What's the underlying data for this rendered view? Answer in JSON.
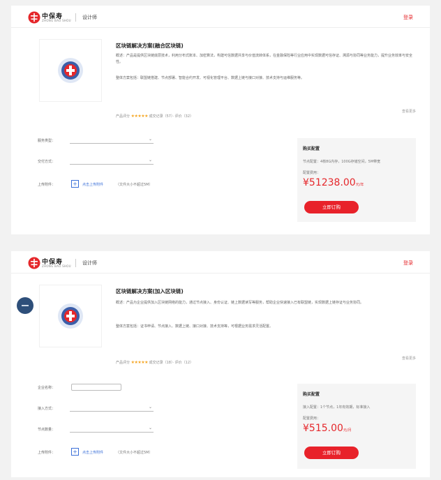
{
  "screens": [
    {
      "header": {
        "brand_cn": "中保寿",
        "brand_en": "ZHONG BAO SHOU",
        "nav": "设计师",
        "login": "登录"
      },
      "product": {
        "title": "区块链解决方案(融合区块链)",
        "desc1": "概述：产品是提供区块链底层技术，利用分布式账本、加密算法，构建可信数据共享与价值流转体系，在金融保险等行业应用中实现数据可信存证、溯源与协同等业务能力，提升业务效率与安全性。",
        "desc2": "整体方案包括：联盟链搭建、节点部署、智能合约开发、可视化管理平台、数据上链与接口对接、技术支持与运维服务等。",
        "rating_label": "产品评分",
        "stars": "★★★★★",
        "rating_meta": "成交记录（57）· 评价（32）",
        "more": "查看更多"
      },
      "form": {
        "field1_label": "服务类型：",
        "field2_label": "交付方式：",
        "upload_label": "上传附件：",
        "upload_link": "点击上传附件",
        "upload_tip": "（文件大小不超过5M）"
      },
      "pricebox": {
        "title": "购买配置",
        "spec": "节点配置：4核8G内存，100G存储空间，5M带宽",
        "price_label": "配置费用：",
        "price": "¥51238.00",
        "unit": "元/年",
        "buy": "立即订购"
      }
    },
    {
      "header": {
        "brand_cn": "中保寿",
        "brand_en": "ZHONG BAO SHOU",
        "nav": "设计师",
        "login": "登录"
      },
      "product": {
        "title": "区块链解决方案(加入区块链)",
        "desc1": "概述：产品为企业提供加入区块链网络的能力，通过节点接入、身份认证、链上数据读写等服务，帮助企业快速接入已有联盟链，实现数据上链存证与业务协同。",
        "desc2": "整体方案包括：证书申请、节点接入、数据上链、接口对接、技术支持等，可根据业务需求灵活配置。",
        "rating_label": "产品评分",
        "stars": "★★★★★",
        "rating_meta": "成交记录（18）· 评价（12）",
        "more": "查看更多"
      },
      "form": {
        "name_label": "企业名称：",
        "name_value": "",
        "field1_label": "接入方式：",
        "field2_label": "节点数量：",
        "upload_label": "上传附件：",
        "upload_link": "点击上传附件",
        "upload_tip": "（文件大小不超过5M）"
      },
      "pricebox": {
        "title": "购买配置",
        "spec": "接入配置：1个节点，1年有效期，标准接入",
        "price_label": "配置费用：",
        "price": "¥515.00",
        "unit": "元/月",
        "buy": "立即订购"
      }
    }
  ],
  "colors": {
    "accent_red": "#e5272b",
    "link_blue": "#3a6fd8",
    "star": "#f5a623",
    "widget": "#2e4f7a"
  },
  "icons": {
    "logo": "red-circle-logo",
    "thumb": "blockchain-emblem",
    "widget": "chat-icon"
  }
}
